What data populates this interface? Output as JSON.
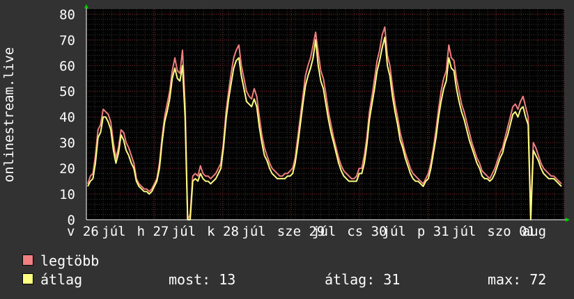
{
  "chart_data": {
    "type": "line",
    "ylabel": "onlinestream.live",
    "ylim": [
      0,
      82
    ],
    "yticks": [
      0,
      10,
      20,
      30,
      40,
      50,
      60,
      70,
      80
    ],
    "grid": true,
    "x_ticks": [
      "v 26",
      "júl",
      "h 27",
      "júl",
      "k 28",
      "júl",
      "sze 29",
      "júl",
      "cs 30",
      "júl",
      "p 31",
      "júl",
      "szo 01",
      "aug"
    ],
    "series": [
      {
        "name": "legtöbb",
        "color": "#f08080",
        "values": [
          14,
          17,
          18,
          25,
          35,
          37,
          43,
          42,
          41,
          38,
          30,
          24,
          28,
          35,
          34,
          30,
          28,
          25,
          22,
          16,
          14,
          13,
          12,
          12,
          11,
          12,
          14,
          16,
          22,
          32,
          40,
          45,
          50,
          58,
          63,
          58,
          57,
          66,
          45,
          0,
          2,
          17,
          18,
          17,
          21,
          18,
          17,
          17,
          16,
          17,
          18,
          20,
          22,
          30,
          42,
          50,
          57,
          63,
          66,
          68,
          60,
          55,
          50,
          48,
          47,
          51,
          48,
          40,
          33,
          28,
          25,
          22,
          20,
          19,
          18,
          17,
          17,
          18,
          18,
          19,
          20,
          24,
          32,
          40,
          48,
          56,
          60,
          63,
          68,
          73,
          65,
          58,
          55,
          49,
          42,
          37,
          32,
          28,
          24,
          21,
          19,
          18,
          17,
          16,
          16,
          17,
          20,
          20,
          25,
          32,
          42,
          48,
          55,
          62,
          66,
          72,
          75,
          64,
          60,
          52,
          45,
          40,
          34,
          30,
          26,
          23,
          20,
          18,
          17,
          16,
          15,
          14,
          16,
          18,
          22,
          28,
          35,
          43,
          50,
          55,
          58,
          68,
          63,
          62,
          55,
          50,
          45,
          42,
          38,
          34,
          30,
          27,
          24,
          22,
          19,
          18,
          17,
          16,
          18,
          20,
          23,
          26,
          28,
          32,
          36,
          40,
          44,
          45,
          43,
          46,
          48,
          44,
          40,
          2,
          30,
          28,
          25,
          22,
          20,
          19,
          18,
          17,
          17,
          16,
          15,
          14
        ],
        "label": "legtöbb"
      },
      {
        "name": "átlag",
        "color": "#ffff80",
        "values": [
          13,
          15,
          16,
          22,
          32,
          34,
          40,
          40,
          38,
          35,
          27,
          22,
          26,
          33,
          31,
          27,
          25,
          22,
          20,
          15,
          13,
          12,
          11,
          11,
          10,
          11,
          13,
          15,
          20,
          30,
          38,
          42,
          47,
          55,
          59,
          55,
          54,
          60,
          40,
          0,
          0,
          15,
          16,
          15,
          18,
          16,
          15,
          15,
          14,
          15,
          16,
          18,
          20,
          28,
          39,
          47,
          53,
          59,
          62,
          63,
          56,
          51,
          46,
          45,
          44,
          47,
          44,
          36,
          30,
          25,
          23,
          20,
          18,
          17,
          16,
          16,
          16,
          16,
          17,
          17,
          18,
          22,
          29,
          37,
          45,
          52,
          56,
          59,
          63,
          70,
          60,
          54,
          51,
          45,
          39,
          34,
          30,
          26,
          22,
          19,
          17,
          16,
          15,
          15,
          15,
          15,
          18,
          18,
          22,
          29,
          39,
          45,
          51,
          58,
          62,
          67,
          71,
          60,
          56,
          48,
          42,
          37,
          31,
          28,
          24,
          21,
          18,
          16,
          15,
          15,
          14,
          13,
          15,
          16,
          20,
          26,
          32,
          40,
          46,
          51,
          54,
          63,
          59,
          58,
          51,
          46,
          42,
          39,
          35,
          31,
          28,
          25,
          22,
          20,
          17,
          16,
          16,
          15,
          16,
          18,
          21,
          24,
          26,
          30,
          33,
          37,
          41,
          42,
          40,
          43,
          44,
          40,
          37,
          0,
          27,
          25,
          23,
          20,
          18,
          17,
          16,
          16,
          16,
          15,
          14,
          13
        ],
        "label": "átlag"
      }
    ]
  },
  "legend": {
    "items": [
      {
        "label": "legtöbb",
        "color": "#f08080"
      },
      {
        "label": "átlag",
        "color": "#ffff80"
      }
    ],
    "stats": {
      "most": "most: 13",
      "atlag": "átlag: 31",
      "max": "max: 72"
    }
  }
}
